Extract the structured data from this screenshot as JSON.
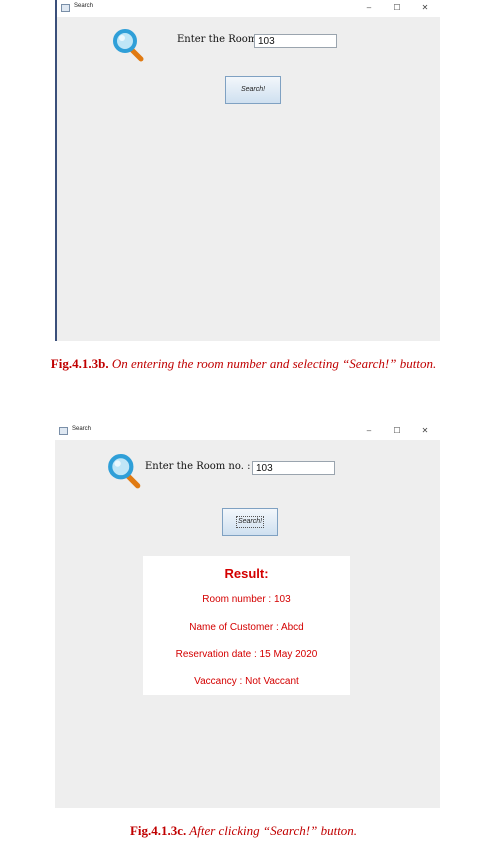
{
  "window1": {
    "title": "Search",
    "controls": {
      "minimize": "–",
      "maximize": "☐",
      "close": "✕"
    },
    "prompt_label": "Enter the Room no. :",
    "room_value": "103",
    "search_button_label": "Search!"
  },
  "caption1": {
    "label": "Fig.4.1.3b.",
    "text": " On entering the room number and selecting “Search!” button."
  },
  "window2": {
    "title": "Search",
    "controls": {
      "minimize": "–",
      "maximize": "☐",
      "close": "✕"
    },
    "prompt_label": "Enter the Room no. :",
    "room_value": "103",
    "search_button_label": "Search!",
    "result": {
      "heading": "Result:",
      "room_number": "Room number : 103",
      "customer_name": "Name of Customer : Abcd",
      "reservation_date": "Reservation date : 15 May 2020",
      "vacancy": "Vaccancy : Not Vaccant"
    }
  },
  "caption2": {
    "label": "Fig.4.1.3c.",
    "text": " After clicking “Search!” button."
  },
  "colors": {
    "window_bg": "#eeeeee",
    "caption_red": "#c00000",
    "result_red": "#d40000"
  }
}
